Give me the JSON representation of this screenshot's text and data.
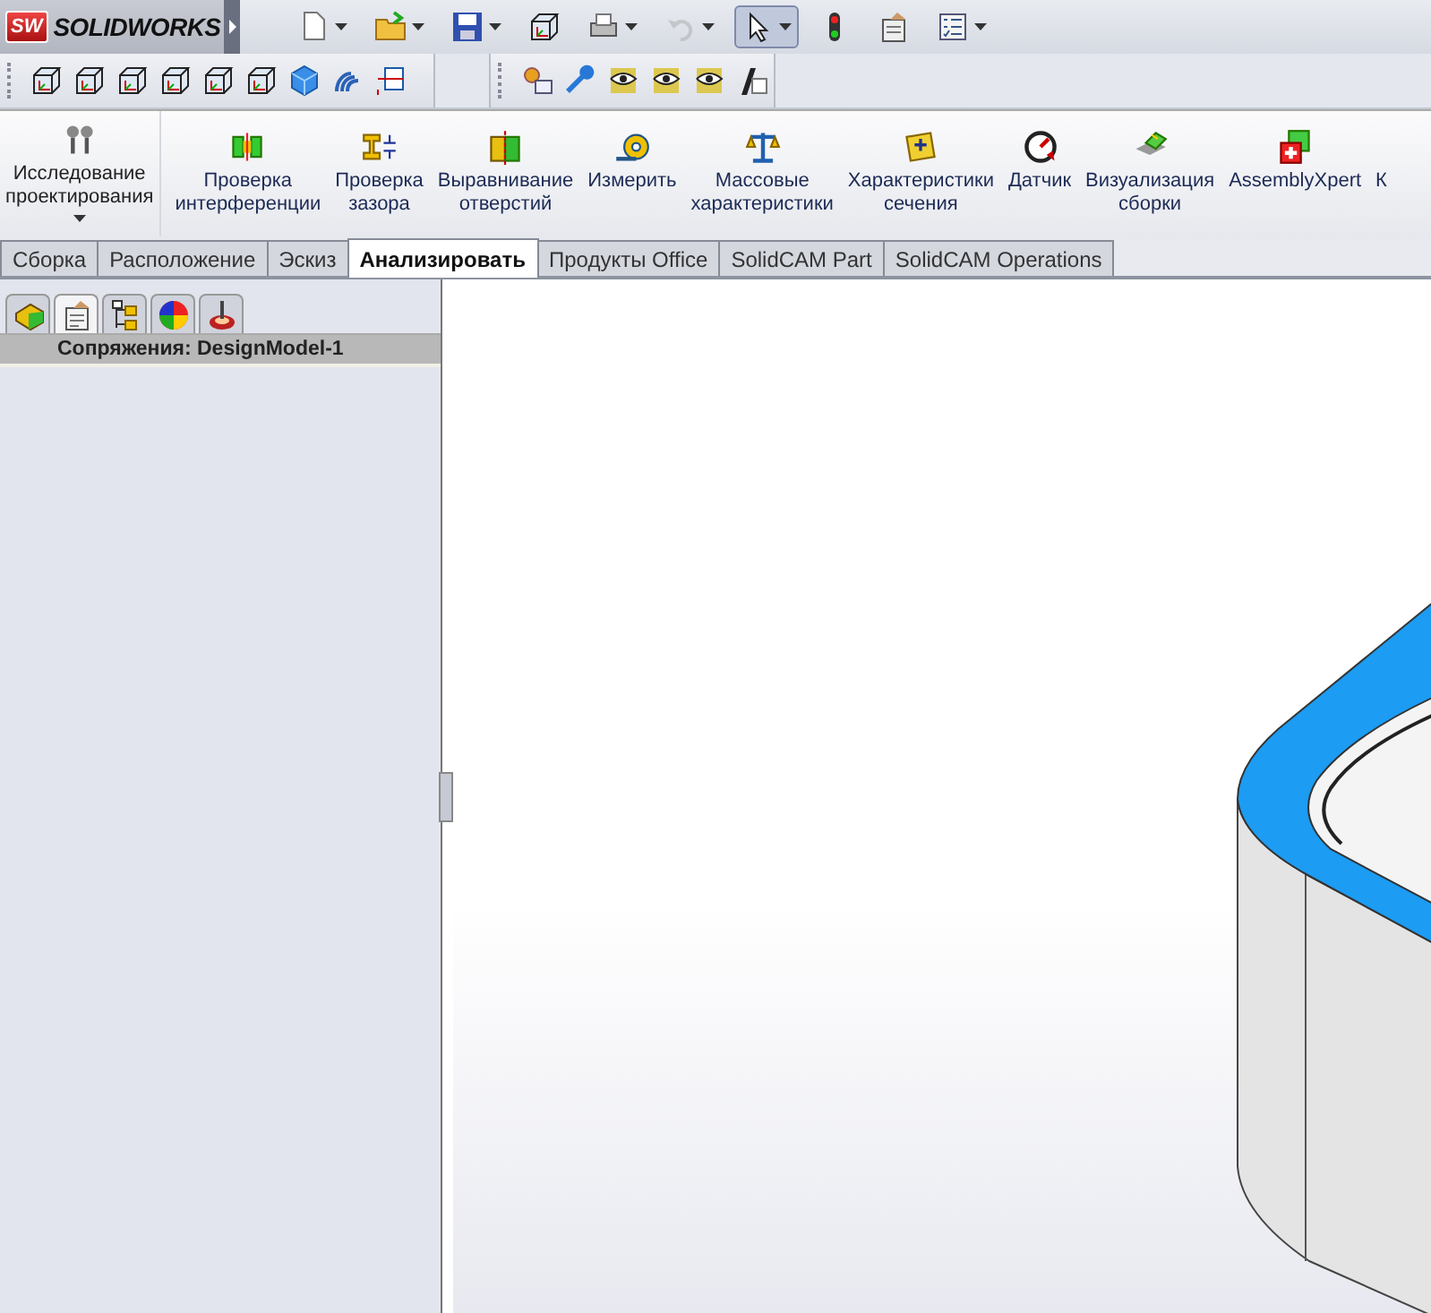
{
  "app": {
    "badge": "SW",
    "name": "SOLIDWORKS"
  },
  "quick_access": [
    {
      "kind": "new",
      "dropdown": true,
      "disabled": false,
      "selected": false
    },
    {
      "kind": "open",
      "dropdown": true,
      "disabled": false,
      "selected": false
    },
    {
      "kind": "save",
      "dropdown": true,
      "disabled": false,
      "selected": false
    },
    {
      "kind": "cube",
      "dropdown": false,
      "disabled": false,
      "selected": false
    },
    {
      "kind": "print",
      "dropdown": true,
      "disabled": false,
      "selected": false
    },
    {
      "kind": "undo",
      "dropdown": true,
      "disabled": true,
      "selected": false
    },
    {
      "kind": "pointer",
      "dropdown": true,
      "disabled": false,
      "selected": true
    },
    {
      "kind": "light",
      "dropdown": false,
      "disabled": false,
      "selected": false
    },
    {
      "kind": "options",
      "dropdown": false,
      "disabled": false,
      "selected": false
    },
    {
      "kind": "list",
      "dropdown": true,
      "disabled": false,
      "selected": false
    }
  ],
  "ribbon": [
    {
      "kind": "probe",
      "label": "Исследование\nпроектирования",
      "dropdown": true
    },
    {
      "kind": "interference",
      "label": "Проверка\nинтерференции",
      "dropdown": false
    },
    {
      "kind": "gap",
      "label": "Проверка\nзазора",
      "dropdown": false
    },
    {
      "kind": "align",
      "label": "Выравнивание\nотверстий",
      "dropdown": false
    },
    {
      "kind": "measure",
      "label": "Измерить",
      "dropdown": false
    },
    {
      "kind": "scales",
      "label": "Массовые\nхарактеристики",
      "dropdown": false
    },
    {
      "kind": "section",
      "label": "Характеристики\nсечения",
      "dropdown": false
    },
    {
      "kind": "gauge",
      "label": "Датчик",
      "dropdown": false
    },
    {
      "kind": "visual",
      "label": "Визуализация\nсборки",
      "dropdown": false
    },
    {
      "kind": "xpert",
      "label": "AssemblyXpert",
      "dropdown": false
    },
    {
      "kind": "none",
      "label": "К",
      "dropdown": false
    }
  ],
  "tabs": [
    {
      "label": "Сборка",
      "selected": false
    },
    {
      "label": "Расположение",
      "selected": false
    },
    {
      "label": "Эскиз",
      "selected": false
    },
    {
      "label": "Анализировать",
      "selected": true
    },
    {
      "label": "Продукты Office",
      "selected": false
    },
    {
      "label": "SolidCAM Part",
      "selected": false
    },
    {
      "label": "SolidCAM Operations",
      "selected": false
    }
  ],
  "panel": {
    "tabs": [
      {
        "kind": "tree",
        "selected": false
      },
      {
        "kind": "property",
        "selected": true
      },
      {
        "kind": "config",
        "selected": false
      },
      {
        "kind": "appearance",
        "selected": false
      },
      {
        "kind": "cam",
        "selected": false
      }
    ],
    "header": "Сопряжения: DesignModel-1"
  }
}
